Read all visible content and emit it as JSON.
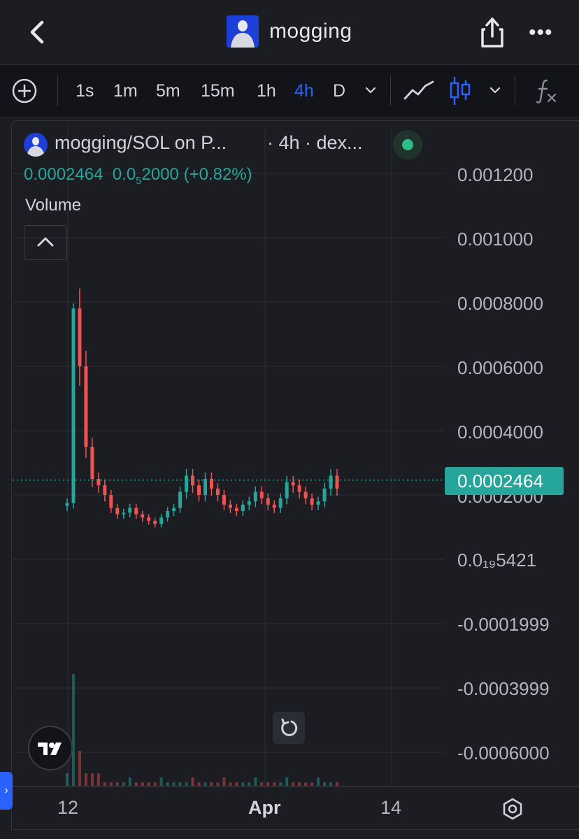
{
  "header": {
    "title": "mogging"
  },
  "toolbar": {
    "intervals": [
      "1s",
      "1m",
      "5m",
      "15m",
      "1h",
      "4h",
      "D"
    ],
    "active_interval": "4h"
  },
  "legend": {
    "symbol": "mogging/SOL on P...",
    "meta": "· 4h · dex...",
    "ohlc_price": "0.0002464",
    "ohlc_change_prefix": "0.0",
    "ohlc_change_sub": "5",
    "ohlc_change_rest": "2000 (+0.82%)",
    "volume_label": "Volume"
  },
  "price_scale": {
    "labels": [
      "0.001200",
      "0.001000",
      "0.0008000",
      "0.0006000",
      "0.0004000",
      "0.0002000",
      "0.0₁₉5421",
      "-0.0001999",
      "-0.0003999",
      "-0.0006000"
    ],
    "last_price": "0.0002464"
  },
  "time_axis": {
    "labels": [
      "12",
      "Apr",
      "14"
    ]
  },
  "colors": {
    "up": "#26a69a",
    "down": "#ef5350",
    "accent": "#2962ff",
    "status": "#2ebd85"
  },
  "chart_data": {
    "type": "candlestick",
    "interval": "4h",
    "y_ticks": [
      0.0012,
      0.001,
      0.0008,
      0.0006,
      0.0004,
      0.0002,
      0,
      -0.0001999,
      -0.0003999,
      -0.0006
    ],
    "last_price": 0.0002464,
    "x_ticks": [
      "12",
      "Apr",
      "14"
    ],
    "candles_approx_close": [
      0.000175,
      0.00078,
      0.0006,
      0.00035,
      0.00025,
      0.00023,
      0.0002,
      0.00016,
      0.00014,
      0.000145,
      0.00016,
      0.00014,
      0.00013,
      0.00012,
      0.00011,
      0.00013,
      0.00015,
      0.00016,
      0.00021,
      0.00026,
      0.00023,
      0.0002,
      0.00025,
      0.00022,
      0.0002,
      0.00017,
      0.00016,
      0.00015,
      0.00017,
      0.00018,
      0.00021,
      0.00019,
      0.00017,
      0.00016,
      0.00019,
      0.00024,
      0.00023,
      0.00021,
      0.00019,
      0.00017,
      0.00018,
      0.00022,
      0.00026,
      0.00022
    ]
  }
}
